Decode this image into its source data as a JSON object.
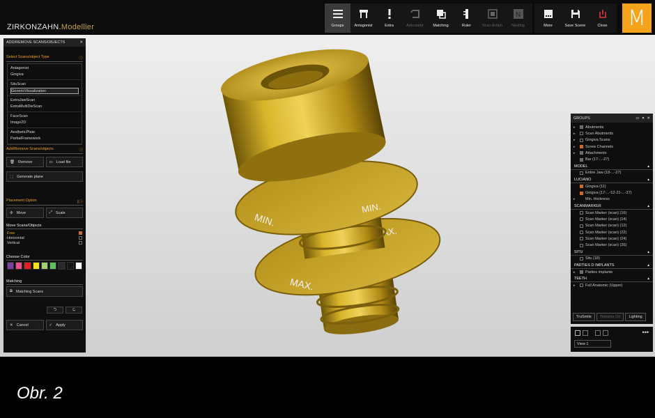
{
  "app": {
    "title_main": "ZIRKONZAHN.",
    "title_sub": "Modellier",
    "logo_letter": "M"
  },
  "toolbar": [
    {
      "label": "Groups",
      "icon": "groups-icon",
      "state": "active"
    },
    {
      "label": "Antagonist",
      "icon": "antagonist-icon",
      "state": "normal"
    },
    {
      "label": "Extra",
      "icon": "exclamation-icon",
      "state": "normal"
    },
    {
      "label": "Articulator",
      "icon": "articulator-icon",
      "state": "disabled"
    },
    {
      "label": "Matching",
      "icon": "matching-icon",
      "state": "normal"
    },
    {
      "label": "Ruler",
      "icon": "ruler-icon",
      "state": "normal"
    },
    {
      "label": "Scan Action",
      "icon": "scan-action-icon",
      "state": "disabled"
    },
    {
      "label": "Nesting",
      "icon": "nesting-icon",
      "state": "disabled"
    }
  ],
  "right_toolbar": [
    {
      "label": "More",
      "icon": "more-icon"
    },
    {
      "label": "Save Scene",
      "icon": "save-icon"
    },
    {
      "label": "Close",
      "icon": "power-icon"
    }
  ],
  "left_panel": {
    "header": "ADD/REMOVE SCANS/OBJECTS",
    "select_title": "Select Scans/object Type",
    "type_groups": [
      [
        "Antagonist",
        "Gingiva"
      ],
      [
        "SituScan",
        "GenericVisualization"
      ],
      [
        "ExtraJawScan",
        "ExtraMultiDieScan"
      ],
      [
        "FaceScan",
        "Image2D"
      ],
      [
        "AestheticPlate",
        "PartialFramework"
      ]
    ],
    "selected_type": "GenericVisualization",
    "add_remove_title": "Add/Remove Scans/objects",
    "remove": "Remove",
    "load_file": "Load file",
    "generate_plane": "Generate plane",
    "placement_title": "Placement Option",
    "move": "Move",
    "scale": "Scale",
    "move_scans_title": "Move Scans/Objects",
    "move_options": [
      {
        "label": "Free",
        "checked": true
      },
      {
        "label": "Horizontal",
        "checked": false
      },
      {
        "label": "Vertical",
        "checked": false
      }
    ],
    "choose_color_title": "Choose Color",
    "colors": [
      "#7b3fa0",
      "#e84f8a",
      "#e02020",
      "#f0e020",
      "#a0d070",
      "#60c060",
      "#2a2a2a",
      "#141414",
      "#ffffff"
    ],
    "matching_title": "Matching",
    "matching_scans": "Matching Scans",
    "cancel": "Cancel",
    "apply": "Apply"
  },
  "groups_panel": {
    "header": "GROUPS",
    "top_items": [
      {
        "label": "Abutments",
        "state": "part",
        "tri": true
      },
      {
        "label": "Scan Abutments",
        "state": "off",
        "tri": true
      },
      {
        "label": "Gingiva Scans",
        "state": "off",
        "tri": true
      },
      {
        "label": "Screw Channels",
        "state": "on",
        "tri": true
      },
      {
        "label": "Attachments",
        "state": "part",
        "tri": true
      },
      {
        "label": "Bar (17-...-27)",
        "state": "part",
        "tri": false
      }
    ],
    "sections": [
      {
        "title": "MODEL",
        "items": [
          {
            "label": "Entire Jaw (18-...-27)",
            "state": "off",
            "tri": false
          }
        ]
      },
      {
        "title": "LUCIANO",
        "items": [
          {
            "label": "Gingiva (11)",
            "state": "on",
            "tri": false
          },
          {
            "label": "Gingiva (17-...-12-21-...-27)",
            "state": "on",
            "tri": false
          },
          {
            "label": "Min. thickness",
            "state": "none",
            "tri": true
          }
        ]
      },
      {
        "title": "SCANMARKER",
        "items": [
          {
            "label": "Scan Marker (scan) (16)",
            "state": "off",
            "tri": false
          },
          {
            "label": "Scan Marker (scan) (14)",
            "state": "off",
            "tri": false
          },
          {
            "label": "Scan Marker (scan) (12)",
            "state": "off",
            "tri": false
          },
          {
            "label": "Scan Marker (scan) (22)",
            "state": "off",
            "tri": false
          },
          {
            "label": "Scan Marker (scan) (24)",
            "state": "off",
            "tri": false
          },
          {
            "label": "Scan Marker (scan) (26)",
            "state": "off",
            "tri": false
          }
        ]
      },
      {
        "title": "SITU",
        "items": [
          {
            "label": "Situ (18)",
            "state": "off",
            "tri": false
          }
        ]
      },
      {
        "title": "PARTIES D IMPLANTS",
        "items": [
          {
            "label": "Parties implants",
            "state": "part",
            "tri": true
          }
        ]
      },
      {
        "title": "TEETH",
        "items": [
          {
            "label": "Full Anatomic (Upper)",
            "state": "off",
            "tri": true
          }
        ]
      }
    ],
    "buttons": [
      {
        "label": "TruSmile",
        "dim": false
      },
      {
        "label": "Textures On",
        "dim": true
      },
      {
        "label": "Lighting",
        "dim": false
      }
    ]
  },
  "view_panel": {
    "view_name": "View 1",
    "more": "•••"
  },
  "scene": {
    "disc_upper_text": "MIN.",
    "disc_lower_text": "MAX.",
    "model_color": "#c9a21c"
  },
  "caption": "Obr. 2"
}
